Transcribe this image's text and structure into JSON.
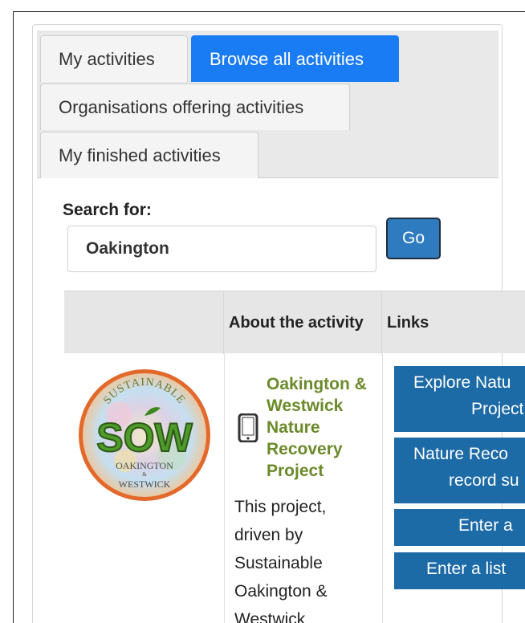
{
  "tabs": [
    {
      "label": "My activities",
      "active": false
    },
    {
      "label": "Browse all activities",
      "active": true
    },
    {
      "label": "Organisations offering activities",
      "active": false
    },
    {
      "label": "My finished activities",
      "active": false
    }
  ],
  "search": {
    "label": "Search for:",
    "value": "Oakington",
    "go_label": "Go"
  },
  "table": {
    "headers": [
      "",
      "About the activity",
      "Links"
    ]
  },
  "activity": {
    "logo": {
      "top_text": "SUSTAINABLE",
      "main_text": "SOW",
      "bottom_text_1": "OAKINGTON",
      "bottom_text_2": "&",
      "bottom_text_3": "WESTWICK"
    },
    "icon": "mobile-phone-icon",
    "title": "Oakington & Westwick Nature Recovery Project",
    "description": "This project, driven by Sustainable Oakington & Westwick",
    "links": [
      {
        "line1": "Explore Natu",
        "line2": "Project r"
      },
      {
        "line1": "Nature Reco",
        "line2": "record su"
      },
      {
        "line1": "Enter a"
      },
      {
        "line1": "Enter a list"
      }
    ]
  },
  "colors": {
    "accent_blue": "#1a7cf5",
    "link_button_blue": "#1c6aa6",
    "go_button": "#2f7bbf",
    "title_green": "#6b8a2a"
  }
}
